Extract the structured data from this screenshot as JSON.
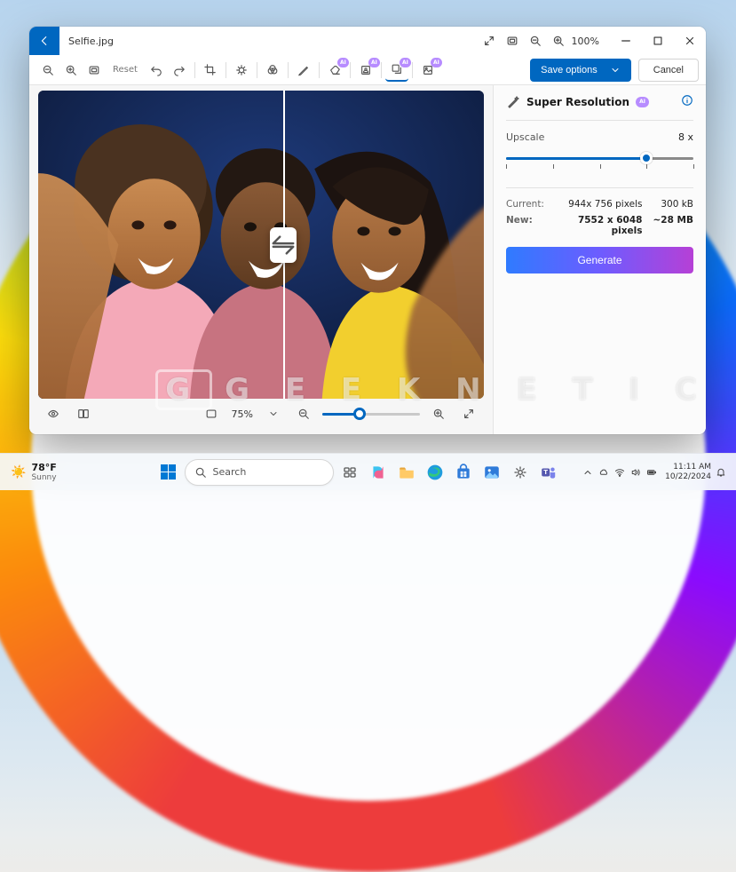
{
  "window": {
    "filename": "Selfie.jpg",
    "titlebar_zoom": "100%"
  },
  "toolbar": {
    "reset_label": "Reset",
    "save_options_label": "Save options",
    "cancel_label": "Cancel"
  },
  "canvas": {
    "bottom_zoom_value": "75%"
  },
  "panel": {
    "title": "Super Resolution",
    "ai_badge": "AI",
    "upscale_label": "Upscale",
    "upscale_value": "8 x",
    "current_label": "Current:",
    "current_dims": "944x 756 pixels",
    "current_size": "300 kB",
    "new_label": "New:",
    "new_dims": "7552 x 6048 pixels",
    "new_size": "~28 MB",
    "generate_label": "Generate"
  },
  "taskbar": {
    "weather_temp": "78°F",
    "weather_cond": "Sunny",
    "search_placeholder": "Search",
    "time": "11:11 AM",
    "date": "10/22/2024"
  },
  "watermark": "GEEKNETIC"
}
